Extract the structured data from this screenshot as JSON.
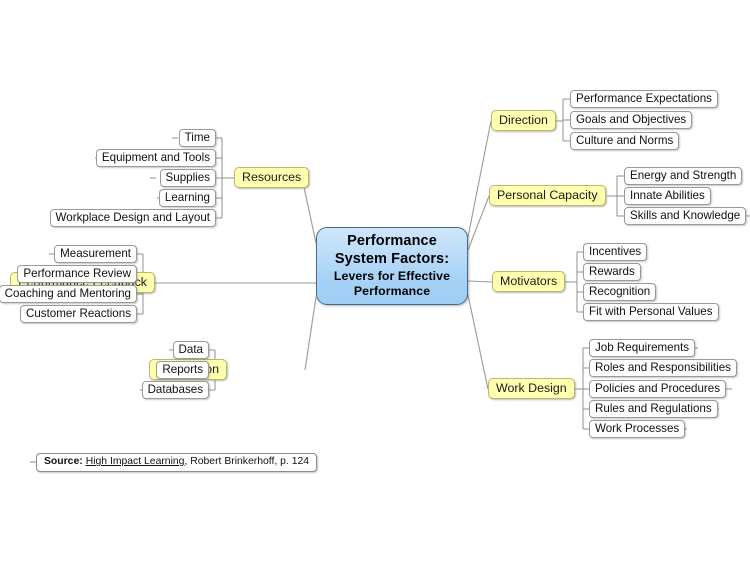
{
  "diagram": {
    "type": "mind-map",
    "title": "Performance System Factors: Levers for Effective Performance",
    "central": {
      "line1": "Performance",
      "line2": "System Factors:",
      "line3": "Levers for Effective",
      "line4": "Performance"
    },
    "colors": {
      "central_fill": "#bfdffa",
      "central_border": "#4a6a8a",
      "main_fill": "#ffffaf",
      "main_border": "#b9b96b",
      "leaf_fill": "#ffffff",
      "leaf_border": "#9a9a9a",
      "connector": "#9a9a9a",
      "background": "#ffffff"
    },
    "branches": [
      {
        "id": "direction",
        "label": "Direction",
        "side": "right",
        "children": [
          "Performance Expectations",
          "Goals and Objectives",
          "Culture and Norms"
        ]
      },
      {
        "id": "personal-capacity",
        "label": "Personal Capacity",
        "side": "right",
        "children": [
          "Energy and Strength",
          "Innate Abilities",
          "Skills and Knowledge"
        ]
      },
      {
        "id": "motivators",
        "label": "Motivators",
        "side": "right",
        "children": [
          "Incentives",
          "Rewards",
          "Recognition",
          "Fit with Personal Values"
        ]
      },
      {
        "id": "work-design",
        "label": "Work Design",
        "side": "right",
        "children": [
          "Job Requirements",
          "Roles and Responsibilities",
          "Policies and Procedures",
          "Rules and Regulations",
          "Work Processes"
        ]
      },
      {
        "id": "resources",
        "label": "Resources",
        "side": "left",
        "children": [
          "Time",
          "Equipment and Tools",
          "Supplies",
          "Learning",
          "Workplace Design and Layout"
        ]
      },
      {
        "id": "performance-feedback",
        "label": "Performance Feedback",
        "side": "left",
        "children": [
          "Measurement",
          "Performance Review",
          "Coaching and Mentoring",
          "Customer Reactions"
        ]
      },
      {
        "id": "information",
        "label": "Information",
        "side": "left",
        "children": [
          "Data",
          "Reports",
          "Databases"
        ]
      }
    ],
    "source": {
      "label": "Source:",
      "title": "High Impact Learning",
      "rest": ", Robert Brinkerhoff, p. 124"
    }
  }
}
